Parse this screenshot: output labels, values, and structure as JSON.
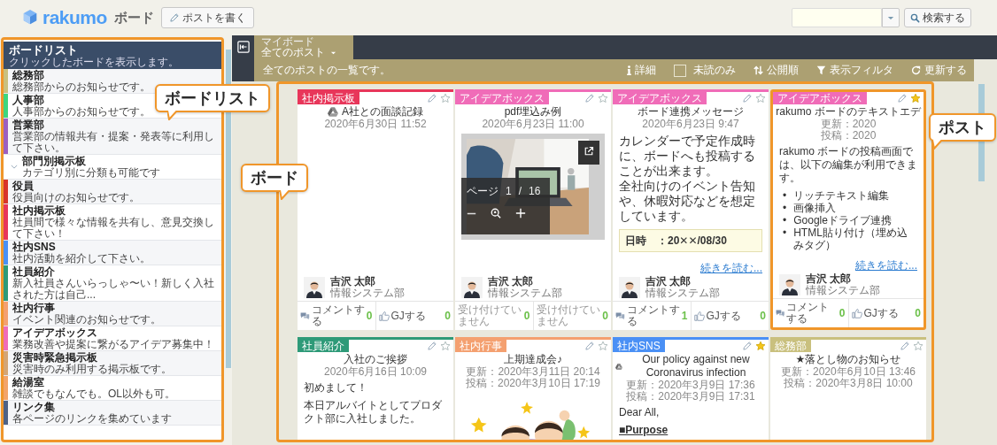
{
  "header": {
    "app_name": "rakumo",
    "section": "ボード",
    "new_post_button": "ポストを書く",
    "search_button": "検索する"
  },
  "sidebar": {
    "title": "ボードリスト",
    "subtitle": "クリックしたボードを表示します。",
    "items": [
      {
        "name": "総務部",
        "description": "総務部からのお知らせです。",
        "color": "#c9c07e"
      },
      {
        "name": "人事部",
        "description": "人事部からのお知らせです。",
        "color": "#3ed67e"
      },
      {
        "name": "営業部",
        "description": "営業部の情報共有・提案・発表等に利用して下さい。",
        "color": "#9c5fc0",
        "children": [
          {
            "name": "部門別掲示板",
            "description": "カテゴリ別に分類も可能です"
          }
        ]
      },
      {
        "name": "役員",
        "description": "役員向けのお知らせです。",
        "color": "#d8352a"
      },
      {
        "name": "社内掲示板",
        "description": "社員間で様々な情報を共有し、意見交換して下さい！",
        "color": "#e8365a"
      },
      {
        "name": "社内SNS",
        "description": "社内活動を紹介して下さい。",
        "color": "#4a90f5"
      },
      {
        "name": "社員紹介",
        "description": "新入社員さんいらっしゃ〜い！新しく入社された方は自己...",
        "color": "#2e9a78"
      },
      {
        "name": "社内行事",
        "description": "イベント関連のお知らせです。",
        "color": "#f4a070"
      },
      {
        "name": "アイデアボックス",
        "description": "業務改善や提案に繋がるアイデア募集中！",
        "color": "#f06cb8"
      },
      {
        "name": "災害時緊急掲示板",
        "description": "災害時のみ利用する掲示板です。",
        "color": "#d4a574"
      },
      {
        "name": "給湯室",
        "description": "雑談でもなんでも。OL以外も可。",
        "color": "#f3a469"
      },
      {
        "name": "リンク集",
        "description": "各ページのリンクを集めています",
        "color": "#4f6285"
      }
    ]
  },
  "board": {
    "tab": {
      "caption": "マイボード",
      "label": "全てのポスト",
      "selected": true
    },
    "description": "全てのポストの一覧です。",
    "toolbar": {
      "details": "詳細",
      "unread_only": {
        "label": "未読のみ",
        "checked": false
      },
      "sort": "公開順",
      "filter": "表示フィルタ",
      "refresh": "更新する"
    }
  },
  "posts": [
    {
      "tag": {
        "label": "社内掲示板",
        "color": "#e8365a"
      },
      "starred": false,
      "highlighted": false,
      "drive": true,
      "title": "A社との面談記録",
      "dates": [
        "2020年6月30日 11:52"
      ],
      "author": {
        "name": "吉沢 太郎",
        "department": "情報システム部"
      },
      "footer": [
        {
          "kind": "comment",
          "label": "コメントする",
          "count": "0"
        },
        {
          "kind": "gj",
          "label": "GJする",
          "count": "0"
        }
      ]
    },
    {
      "tag": {
        "label": "アイデアボックス",
        "color": "#f06cb8"
      },
      "starred": false,
      "highlighted": false,
      "drive": false,
      "title": "pdf埋込み例",
      "dates": [
        "2020年6月23日 11:00"
      ],
      "body": [
        {
          "kind": "pdf",
          "page_label": "ページ",
          "page": "1",
          "separator": "/",
          "total": "16"
        }
      ],
      "author": {
        "name": "吉沢 太郎",
        "department": "情報システム部"
      },
      "footer": [
        {
          "kind": "closed",
          "label": "受け付けていません",
          "count": "0"
        },
        {
          "kind": "closed",
          "label": "受け付けていません",
          "count": "0"
        }
      ]
    },
    {
      "tag": {
        "label": "アイデアボックス",
        "color": "#f06cb8"
      },
      "starred": false,
      "highlighted": false,
      "drive": false,
      "title": "ボード連携メッセージ",
      "dates": [
        "2020年6月23日 9:47"
      ],
      "body": [
        {
          "kind": "lead",
          "text": "カレンダーで予定作成時に、ボードへも投稿することが出来ます。"
        },
        {
          "kind": "lead",
          "text": "全社向けのイベント告知や、休暇対応などを想定しています。"
        },
        {
          "kind": "note",
          "text": "日時　：20✕✕/08/30"
        }
      ],
      "more": "続きを読む...",
      "author": {
        "name": "吉沢 太郎",
        "department": "情報システム部"
      },
      "footer": [
        {
          "kind": "comment",
          "label": "コメントする",
          "count": "1"
        },
        {
          "kind": "gj",
          "label": "GJする",
          "count": "0"
        }
      ]
    },
    {
      "tag": {
        "label": "アイデアボックス",
        "color": "#f06cb8"
      },
      "starred": true,
      "highlighted": true,
      "drive": false,
      "title": "rakumo ボードのテキストエデ",
      "dates": [
        "更新：2020",
        "投稿：2020"
      ],
      "body": [
        {
          "kind": "para",
          "text": "rakumo ボードの投稿画面では、以下の編集が利用できます。"
        },
        {
          "kind": "bullets",
          "marker": "•",
          "items": [
            "リッチテキスト編集",
            "画像挿入",
            "Googleドライブ連携",
            "HTML貼り付け（埋め込みタグ）"
          ]
        }
      ],
      "more": "続きを読む...",
      "author": {
        "name": "吉沢 太郎",
        "department": "情報システム部"
      },
      "footer": [
        {
          "kind": "comment",
          "label": "コメントする",
          "count": "0"
        },
        {
          "kind": "gj",
          "label": "GJする",
          "count": "0"
        }
      ]
    },
    {
      "tag": {
        "label": "社員紹介",
        "color": "#2e9a78"
      },
      "starred": false,
      "highlighted": false,
      "drive": false,
      "title": "入社のご挨拶",
      "dates": [
        "2020年6月16日 10:09"
      ],
      "body": [
        {
          "kind": "para",
          "text": "初めまして！"
        },
        {
          "kind": "para",
          "text": "本日アルバイトとしてプロダクト部に入社しました。"
        }
      ]
    },
    {
      "tag": {
        "label": "社内行事",
        "color": "#f4a070"
      },
      "starred": false,
      "highlighted": false,
      "drive": false,
      "title": "上期達成会♪",
      "dates": [
        "更新：2020年3月11日 20:14",
        "投稿：2020年3月10日 17:19"
      ],
      "body": [
        {
          "kind": "picture"
        }
      ]
    },
    {
      "tag": {
        "label": "社内SNS",
        "color": "#4a90f5"
      },
      "starred": true,
      "highlighted": false,
      "drive": true,
      "title": "Our policy against new Coronavirus infection",
      "dates": [
        "更新：2020年3月9日 17:36",
        "投稿：2020年3月9日 17:31"
      ],
      "body": [
        {
          "kind": "para",
          "text": "Dear All,"
        },
        {
          "kind": "heading",
          "text": "■Purpose"
        }
      ]
    },
    {
      "tag": {
        "label": "総務部",
        "color": "#c9c07e"
      },
      "starred": false,
      "highlighted": false,
      "drive": false,
      "title": "★落とし物のお知らせ",
      "dates": [
        "更新：2020年6月10日 13:46",
        "投稿：2020年3月8日 10:00"
      ]
    }
  ],
  "annotations": [
    {
      "label": "ボードリスト"
    },
    {
      "label": "ボード"
    },
    {
      "label": "ポスト"
    }
  ]
}
